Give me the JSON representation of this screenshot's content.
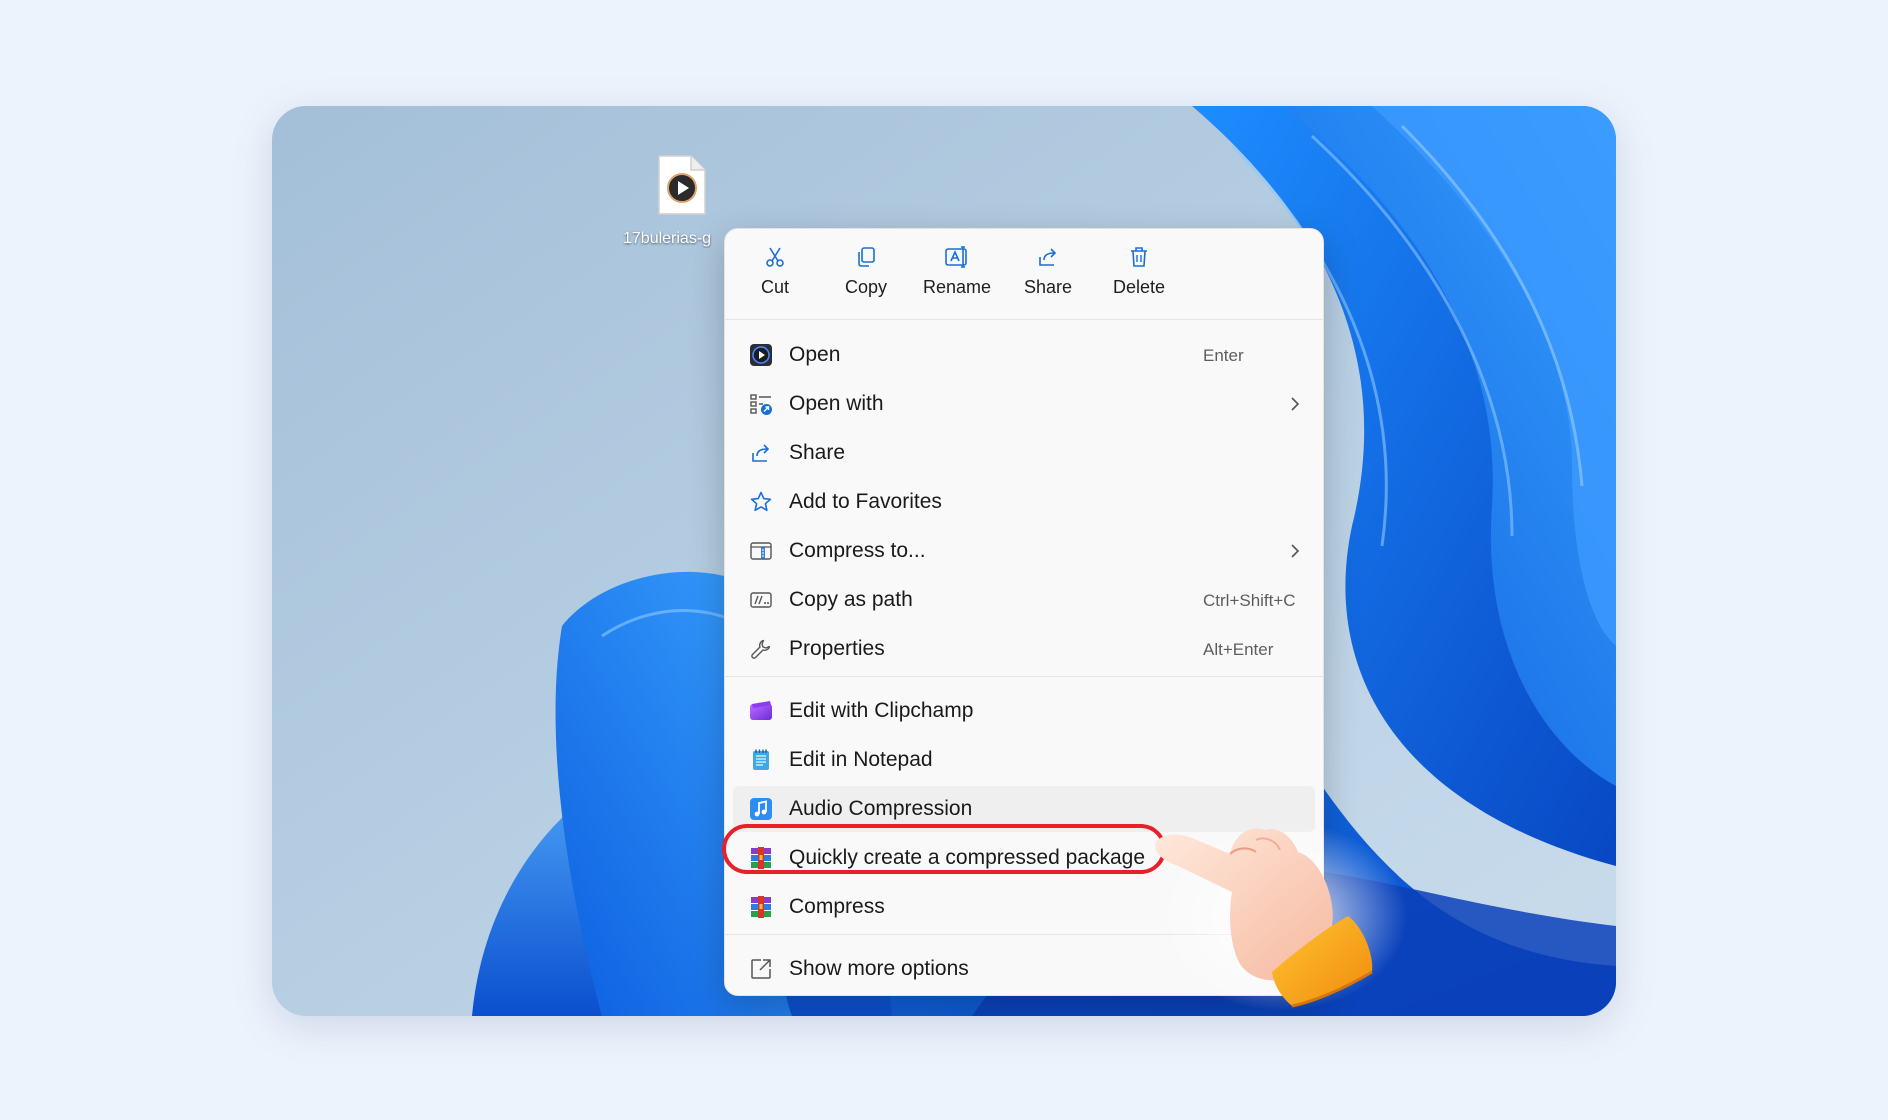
{
  "desktop": {
    "file": {
      "name": "17bulerias-g",
      "icon": "media-file-icon"
    }
  },
  "context_menu": {
    "quick_actions": [
      {
        "label": "Cut",
        "icon": "scissors-icon"
      },
      {
        "label": "Copy",
        "icon": "copy-icon"
      },
      {
        "label": "Rename",
        "icon": "rename-icon"
      },
      {
        "label": "Share",
        "icon": "share-icon"
      },
      {
        "label": "Delete",
        "icon": "trash-icon"
      }
    ],
    "items": [
      {
        "label": "Open",
        "shortcut": "Enter",
        "icon": "media-player-icon"
      },
      {
        "label": "Open with",
        "shortcut": "",
        "submenu": true,
        "icon": "open-with-icon"
      },
      {
        "label": "Share",
        "shortcut": "",
        "icon": "share-icon"
      },
      {
        "label": "Add to Favorites",
        "shortcut": "",
        "icon": "star-icon"
      },
      {
        "label": "Compress to...",
        "shortcut": "",
        "submenu": true,
        "icon": "zip-folder-icon"
      },
      {
        "label": "Copy as path",
        "shortcut": "Ctrl+Shift+C",
        "icon": "copy-path-icon"
      },
      {
        "label": "Properties",
        "shortcut": "Alt+Enter",
        "icon": "wrench-icon"
      }
    ],
    "app_items": [
      {
        "label": "Edit with Clipchamp",
        "icon": "clipchamp-icon"
      },
      {
        "label": "Edit in Notepad",
        "icon": "notepad-icon"
      },
      {
        "label": "Audio Compression",
        "icon": "audio-compression-icon",
        "hovered": true
      },
      {
        "label": "Quickly create a compressed package",
        "icon": "archive-icon",
        "highlighted": true
      },
      {
        "label": "Compress",
        "icon": "archive-icon"
      }
    ],
    "footer": {
      "label": "Show more options",
      "icon": "show-more-icon"
    }
  },
  "colors": {
    "highlight_ring": "#e8202a",
    "menu_bg": "#f9f9f9",
    "accent": "#1a6fd6"
  }
}
